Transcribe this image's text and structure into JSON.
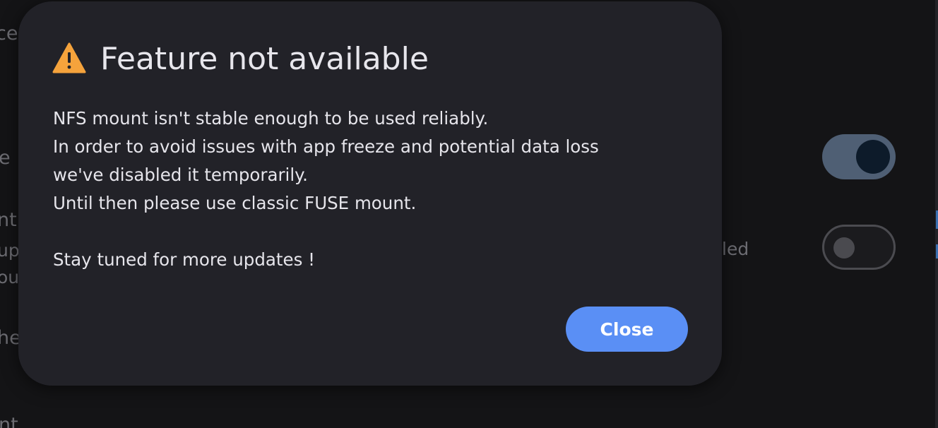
{
  "background": {
    "labels": [
      "ce",
      "e",
      "nt",
      "up",
      "ou",
      "he",
      "nt"
    ],
    "status_fragment": "led",
    "toggles": [
      {
        "state": "on"
      },
      {
        "state": "off"
      }
    ]
  },
  "dialog": {
    "icon": "warning-icon",
    "title": "Feature not available",
    "lines": [
      "NFS mount isn't stable enough to be used reliably.",
      "In order to avoid issues with app freeze and potential data loss",
      "we've disabled it temporarily.",
      "Until then please use classic FUSE mount.",
      "",
      "Stay tuned for more updates !"
    ],
    "close_label": "Close"
  },
  "colors": {
    "dialog_bg": "#222228",
    "accent": "#5a8ff5",
    "warning": "#f5a33c"
  }
}
